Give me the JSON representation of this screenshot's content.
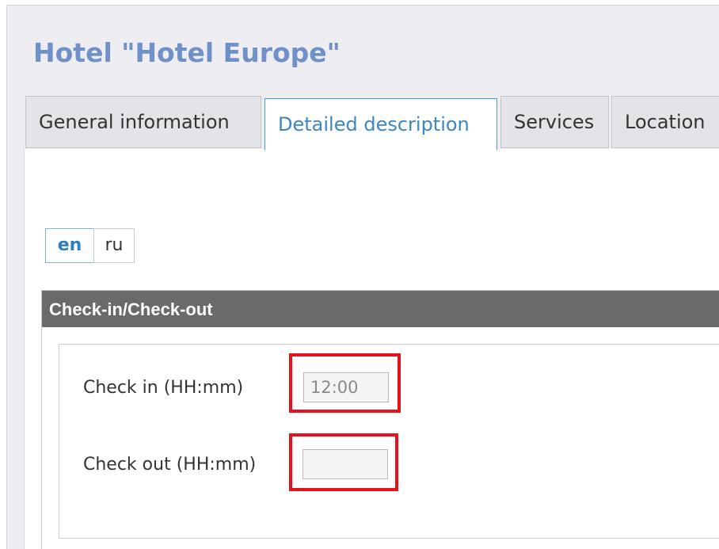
{
  "hotel": {
    "title": "Hotel \"Hotel Europe\""
  },
  "tabs": [
    {
      "label": "General information",
      "active": false
    },
    {
      "label": "Detailed description",
      "active": true
    },
    {
      "label": "Services",
      "active": false
    },
    {
      "label": "Location",
      "active": false
    }
  ],
  "languages": [
    {
      "code": "en",
      "active": true
    },
    {
      "code": "ru",
      "active": false
    }
  ],
  "checkin_section": {
    "header": "Check-in/Check-out",
    "check_in": {
      "label": "Check in (HH:mm)",
      "value": "12:00",
      "placeholder": ""
    },
    "check_out": {
      "label": "Check out (HH:mm)",
      "value": "",
      "placeholder": ""
    }
  },
  "colors": {
    "title": "#6f90c9",
    "active_tab": "#3b86c6",
    "section_header_bg": "#6a6a6a",
    "highlight": "#e8101a"
  }
}
